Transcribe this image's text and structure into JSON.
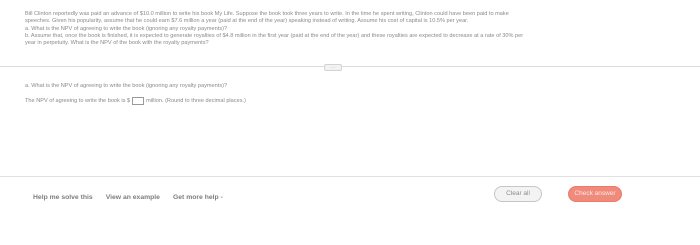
{
  "problem": {
    "line1": "Bill Clinton reportedly was paid an advance of $10.0 million to write his book My Life. Suppose the book took three years to write. In the time he spent writing, Clinton could have been paid to make",
    "line2": "speeches. Given his popularity, assume that he could earn $7.6 million a year (paid at the end of the year) speaking instead of writing. Assume his cost of capital is 10.5% per year.",
    "line3": "a. What is the NPV of agreeing to write the book (ignoring any royalty payments)?",
    "line4": "b. Assume that, once the book is finished, it is expected to generate royalties of $4.8 million in the first year (paid at the end of the year) and these royalties are expected to decrease at a rate of 30% per",
    "line5": "year in perpetuity. What is the NPV of the book with the royalty payments?"
  },
  "expand_handle": "···",
  "part_a": {
    "question": "a. What is the NPV of agreeing to write the book (ignoring any royalty payments)?",
    "answer_prefix": "The NPV of agreeing to write the book is $",
    "answer_suffix": "million. (Round to three decimal places.)"
  },
  "footer": {
    "help_label": "Help me solve this",
    "example_label": "View an example",
    "more_help_label": "Get more help -",
    "clear_label": "Clear all",
    "check_label": "Check answer"
  }
}
